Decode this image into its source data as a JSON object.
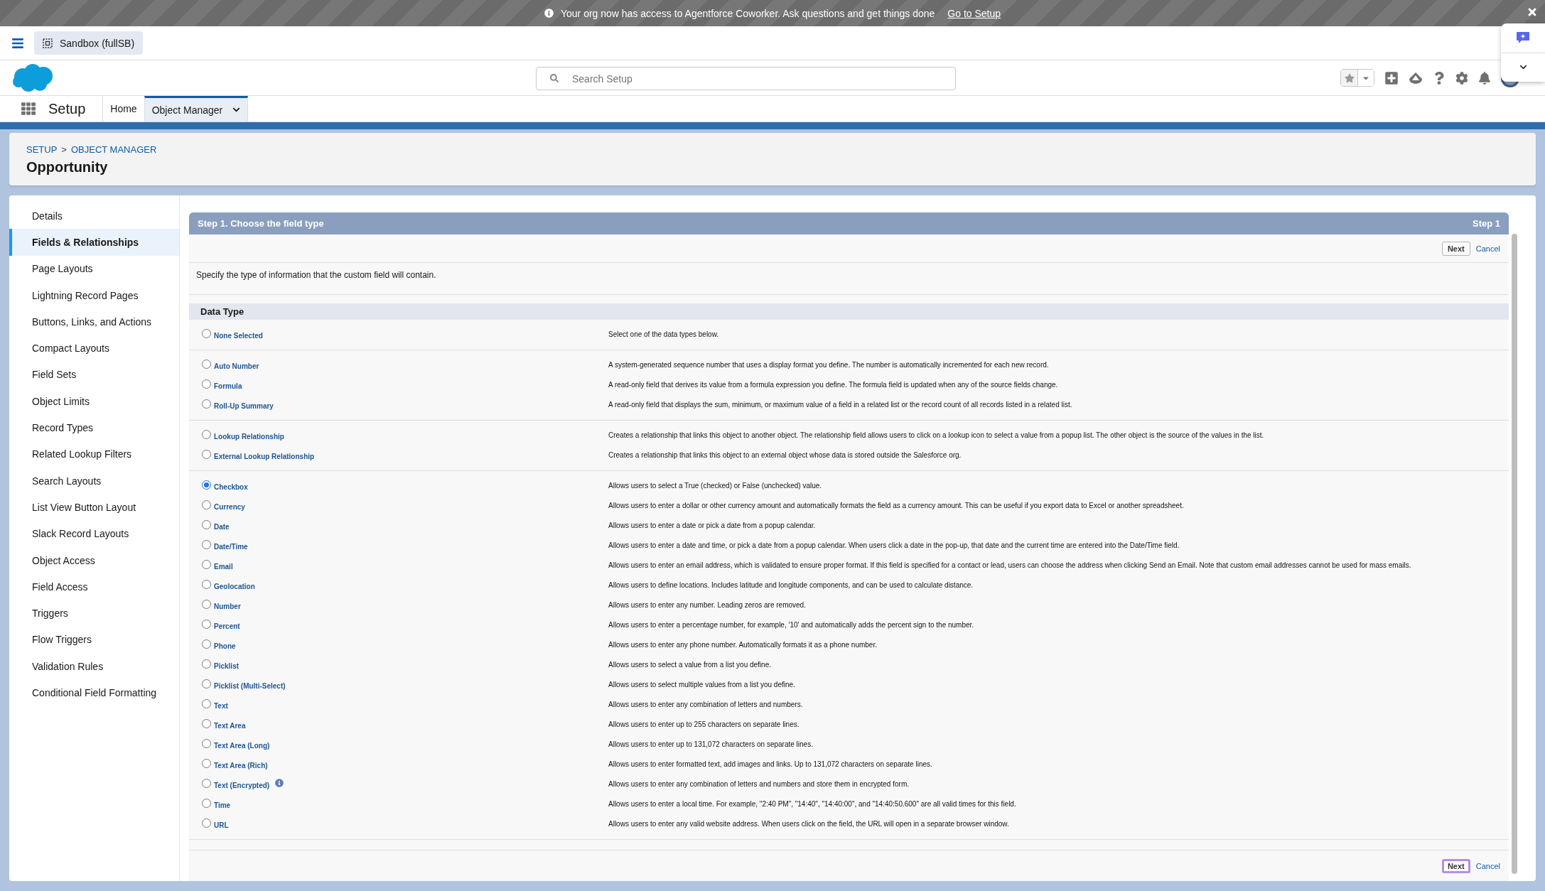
{
  "banner": {
    "message": "Your org now has access to Agentforce Coworker. Ask questions and get things done",
    "link": "Go to Setup"
  },
  "org": {
    "label": "Sandbox (fullSB)"
  },
  "search": {
    "placeholder": "Search Setup"
  },
  "nav": {
    "app_name": "Setup",
    "tabs": [
      {
        "label": "Home",
        "selected": false,
        "dropdown": false
      },
      {
        "label": "Object Manager",
        "selected": true,
        "dropdown": true
      }
    ]
  },
  "breadcrumb": {
    "items": [
      "SETUP",
      "OBJECT MANAGER"
    ],
    "separator": ">"
  },
  "title": "Opportunity",
  "sidebar": {
    "items": [
      {
        "label": "Details",
        "selected": false
      },
      {
        "label": "Fields & Relationships",
        "selected": true
      },
      {
        "label": "Page Layouts",
        "selected": false
      },
      {
        "label": "Lightning Record Pages",
        "selected": false
      },
      {
        "label": "Buttons, Links, and Actions",
        "selected": false
      },
      {
        "label": "Compact Layouts",
        "selected": false
      },
      {
        "label": "Field Sets",
        "selected": false
      },
      {
        "label": "Object Limits",
        "selected": false
      },
      {
        "label": "Record Types",
        "selected": false
      },
      {
        "label": "Related Lookup Filters",
        "selected": false
      },
      {
        "label": "Search Layouts",
        "selected": false
      },
      {
        "label": "List View Button Layout",
        "selected": false
      },
      {
        "label": "Slack Record Layouts",
        "selected": false
      },
      {
        "label": "Object Access",
        "selected": false
      },
      {
        "label": "Field Access",
        "selected": false
      },
      {
        "label": "Triggers",
        "selected": false
      },
      {
        "label": "Flow Triggers",
        "selected": false
      },
      {
        "label": "Validation Rules",
        "selected": false
      },
      {
        "label": "Conditional Field Formatting",
        "selected": false
      }
    ]
  },
  "wizard": {
    "title": "Step 1. Choose the field type",
    "step": "Step 1",
    "top_buttons": {
      "next": "Next",
      "cancel": "Cancel",
      "focused": false
    },
    "instruction": "Specify the type of information that the custom field will contain.",
    "section_title": "Data Type",
    "groups": [
      [
        {
          "label": "None Selected",
          "description": "Select one of the data types below.",
          "selected": false,
          "info": false
        }
      ],
      [
        {
          "label": "Auto Number",
          "description": "A system-generated sequence number that uses a display format you define. The number is automatically incremented for each new record.",
          "selected": false,
          "info": false
        },
        {
          "label": "Formula",
          "description": "A read-only field that derives its value from a formula expression you define. The formula field is updated when any of the source fields change.",
          "selected": false,
          "info": false
        },
        {
          "label": "Roll-Up Summary",
          "description": "A read-only field that displays the sum, minimum, or maximum value of a field in a related list or the record count of all records listed in a related list.",
          "selected": false,
          "info": false
        }
      ],
      [
        {
          "label": "Lookup Relationship",
          "description": "Creates a relationship that links this object to another object. The relationship field allows users to click on a lookup icon to select a value from a popup list. The other object is the source of the values in the list.",
          "selected": false,
          "info": false
        },
        {
          "label": "External Lookup Relationship",
          "description": "Creates a relationship that links this object to an external object whose data is stored outside the Salesforce org.",
          "selected": false,
          "info": false
        }
      ],
      [
        {
          "label": "Checkbox",
          "description": "Allows users to select a True (checked) or False (unchecked) value.",
          "selected": true,
          "info": false
        },
        {
          "label": "Currency",
          "description": "Allows users to enter a dollar or other currency amount and automatically formats the field as a currency amount. This can be useful if you export data to Excel or another spreadsheet.",
          "selected": false,
          "info": false
        },
        {
          "label": "Date",
          "description": "Allows users to enter a date or pick a date from a popup calendar.",
          "selected": false,
          "info": false
        },
        {
          "label": "Date/Time",
          "description": "Allows users to enter a date and time, or pick a date from a popup calendar. When users click a date in the pop-up, that date and the current time are entered into the Date/Time field.",
          "selected": false,
          "info": false
        },
        {
          "label": "Email",
          "description": "Allows users to enter an email address, which is validated to ensure proper format. If this field is specified for a contact or lead, users can choose the address when clicking Send an Email. Note that custom email addresses cannot be used for mass emails.",
          "selected": false,
          "info": false
        },
        {
          "label": "Geolocation",
          "description": "Allows users to define locations. Includes latitude and longitude components, and can be used to calculate distance.",
          "selected": false,
          "info": false
        },
        {
          "label": "Number",
          "description": "Allows users to enter any number. Leading zeros are removed.",
          "selected": false,
          "info": false
        },
        {
          "label": "Percent",
          "description": "Allows users to enter a percentage number, for example, '10' and automatically adds the percent sign to the number.",
          "selected": false,
          "info": false
        },
        {
          "label": "Phone",
          "description": "Allows users to enter any phone number. Automatically formats it as a phone number.",
          "selected": false,
          "info": false
        },
        {
          "label": "Picklist",
          "description": "Allows users to select a value from a list you define.",
          "selected": false,
          "info": false
        },
        {
          "label": "Picklist (Multi-Select)",
          "description": "Allows users to select multiple values from a list you define.",
          "selected": false,
          "info": false
        },
        {
          "label": "Text",
          "description": "Allows users to enter any combination of letters and numbers.",
          "selected": false,
          "info": false
        },
        {
          "label": "Text Area",
          "description": "Allows users to enter up to 255 characters on separate lines.",
          "selected": false,
          "info": false
        },
        {
          "label": "Text Area (Long)",
          "description": "Allows users to enter up to 131,072 characters on separate lines.",
          "selected": false,
          "info": false
        },
        {
          "label": "Text Area (Rich)",
          "description": "Allows users to enter formatted text, add images and links. Up to 131,072 characters on separate lines.",
          "selected": false,
          "info": false
        },
        {
          "label": "Text (Encrypted)",
          "description": "Allows users to enter any combination of letters and numbers and store them in encrypted form.",
          "selected": false,
          "info": true
        },
        {
          "label": "Time",
          "description": "Allows users to enter a local time. For example, \"2:40 PM\", \"14:40\", \"14:40:00\", and \"14:40:50.600\" are all valid times for this field.",
          "selected": false,
          "info": false
        },
        {
          "label": "URL",
          "description": "Allows users to enter any valid website address. When users click on the field, the URL will open in a separate browser window.",
          "selected": false,
          "info": false
        }
      ]
    ],
    "bottom_buttons": {
      "next": "Next",
      "cancel": "Cancel",
      "focused": true
    }
  }
}
